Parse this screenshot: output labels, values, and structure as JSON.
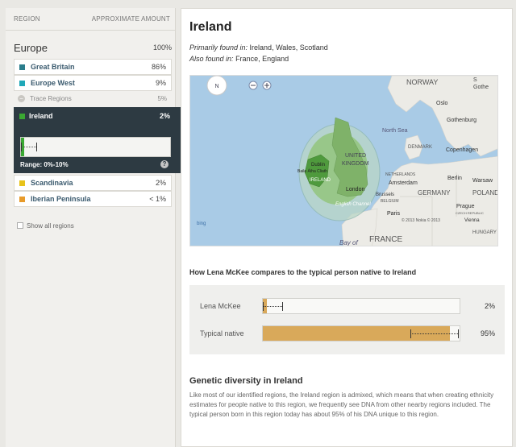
{
  "sidebar": {
    "header": {
      "region": "REGION",
      "amount": "APPROXIMATE AMOUNT"
    },
    "continent": {
      "name": "Europe",
      "percent": "100%"
    },
    "regions": [
      {
        "label": "Great Britain",
        "percent": "86%",
        "color": "#2a7d8c"
      },
      {
        "label": "Europe West",
        "percent": "9%",
        "color": "#1fa8b8"
      }
    ],
    "trace": {
      "label": "Trace Regions",
      "percent": "5%",
      "icon": "minus-circle-icon"
    },
    "selected": {
      "label": "Ireland",
      "percent": "2%",
      "color": "#3aa832",
      "estimate_fraction": 0.02,
      "range_low_fraction": 0.0,
      "range_high_fraction": 0.1,
      "range_label": "Range: 0%-10%",
      "help_glyph": "?"
    },
    "trace_regions": [
      {
        "label": "Scandinavia",
        "percent": "2%",
        "color": "#e8c31a"
      },
      {
        "label": "Iberian Peninsula",
        "percent": "< 1%",
        "color": "#e89b2a"
      }
    ],
    "show_all": "Show all regions"
  },
  "main": {
    "title": "Ireland",
    "primarily_prefix": "Primarily found in:",
    "primarily_places": "Ireland, Wales, Scotland",
    "also_prefix": "Also found in:",
    "also_places": "France, England",
    "map": {
      "labels": {
        "norway": "NORWAY",
        "oslo": "Oslo",
        "gothenburg": "Gothenburg",
        "north_sea": "North Sea",
        "denmark": "DENMARK",
        "copenhagen": "Copenhagen",
        "united": "UNITED",
        "kingdom": "KINGDOM",
        "dublin": "Dublin",
        "baile": "Baile Átha Cliath",
        "ireland": "IRELAND",
        "london": "London",
        "netherlands": "NETHERLANDS",
        "amsterdam": "Amsterdam",
        "berlin": "Berlin",
        "warsaw": "Warsaw",
        "germany": "GERMANY",
        "poland": "POLAND",
        "brussels": "Brussels",
        "belgium": "BELGIUM",
        "prague": "Prague",
        "czech": "CZECH REPUBLIC",
        "english_channel": "English Channel",
        "paris": "Paris",
        "vienna": "Vienna",
        "hungary": "HUNGARY",
        "france": "FRANCE",
        "bay_of": "Bay of",
        "copyright": "© 2013 Nokia  © 2013",
        "bing": "bing",
        "n": "N",
        "ba": "Ba",
        "goth_short": "Gothe"
      }
    },
    "compare": {
      "title": "How Lena McKee compares to the typical person native to Ireland",
      "rows": [
        {
          "label": "Lena McKee",
          "percent": "2%",
          "fill": 0.02,
          "range_low": 0.0,
          "range_high": 0.1
        },
        {
          "label": "Typical native",
          "percent": "95%",
          "fill": 0.95,
          "range_low": 0.75,
          "range_high": 0.99
        }
      ],
      "color": "#d9a95a"
    },
    "diversity": {
      "title": "Genetic diversity in Ireland",
      "text": "Like most of our identified regions, the Ireland region is admixed, which means that when creating ethnicity estimates for people native to this region, we frequently see DNA from other nearby regions included. The typical person born in this region today has about 95% of his DNA unique to this region."
    }
  }
}
